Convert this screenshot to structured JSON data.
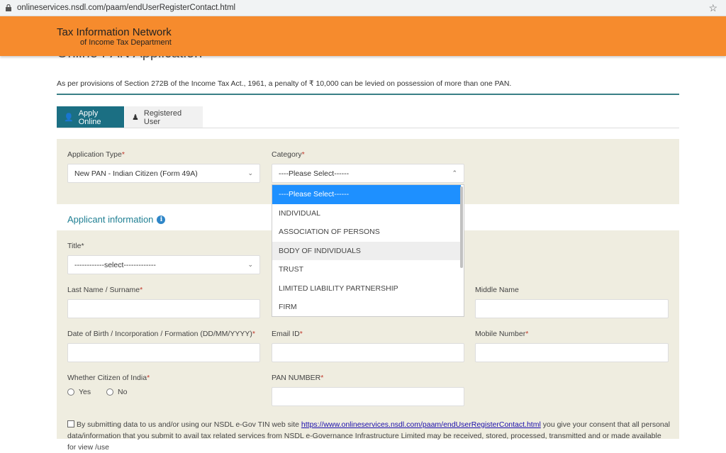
{
  "browser": {
    "url": "onlineservices.nsdl.com/paam/endUserRegisterContact.html"
  },
  "header": {
    "brand_line1": "Tax Information Network",
    "brand_line2": "of Income Tax Department",
    "bg_color": "#f68b2d"
  },
  "page": {
    "title": "Online PAN Application",
    "notice": "As per provisions of Section 272B of the Income Tax Act., 1961, a penalty of ₹ 10,000 can be levied on possession of more than one PAN."
  },
  "tabs": [
    {
      "label": "Apply Online",
      "active": true
    },
    {
      "label": "Registered User",
      "active": false
    }
  ],
  "form": {
    "application_type": {
      "label": "Application Type",
      "value": "New PAN - Indian Citizen (Form 49A)"
    },
    "category": {
      "label": "Category",
      "value": "----Please Select------",
      "options": [
        "----Please Select------",
        "INDIVIDUAL",
        "ASSOCIATION OF PERSONS",
        "BODY OF INDIVIDUALS",
        "TRUST",
        "LIMITED LIABILITY PARTNERSHIP",
        "FIRM"
      ],
      "hovered": "BODY OF INDIVIDUALS"
    },
    "section_title": "Applicant information",
    "title": {
      "label": "Title",
      "value": "------------select-------------"
    },
    "last_name": {
      "label": "Last Name / Surname",
      "value": ""
    },
    "middle_name": {
      "label": "Middle Name",
      "value": ""
    },
    "dob": {
      "label": "Date of Birth / Incorporation / Formation (DD/MM/YYYY)",
      "value": ""
    },
    "email": {
      "label": "Email ID",
      "value": ""
    },
    "mobile": {
      "label": "Mobile Number",
      "value": ""
    },
    "citizen": {
      "label": "Whether Citizen of India",
      "yes": "Yes",
      "no": "No"
    },
    "pan": {
      "label": "PAN NUMBER",
      "value": ""
    },
    "required_mark": "*",
    "consent": {
      "before": "By submitting data to us and/or using our NSDL e-Gov TIN web site ",
      "link": "https://www.onlineservices.nsdl.com/paam/endUserRegisterContact.html",
      "after": " you give your consent that all personal data/information that you submit to avail tax related services from NSDL e-Governance Infrastructure Limited may be received, stored, processed, transmitted and or made available for view /use"
    }
  },
  "colors": {
    "accent": "#1b6f83",
    "panel": "#efede0",
    "selected_option": "#1e90ff"
  }
}
